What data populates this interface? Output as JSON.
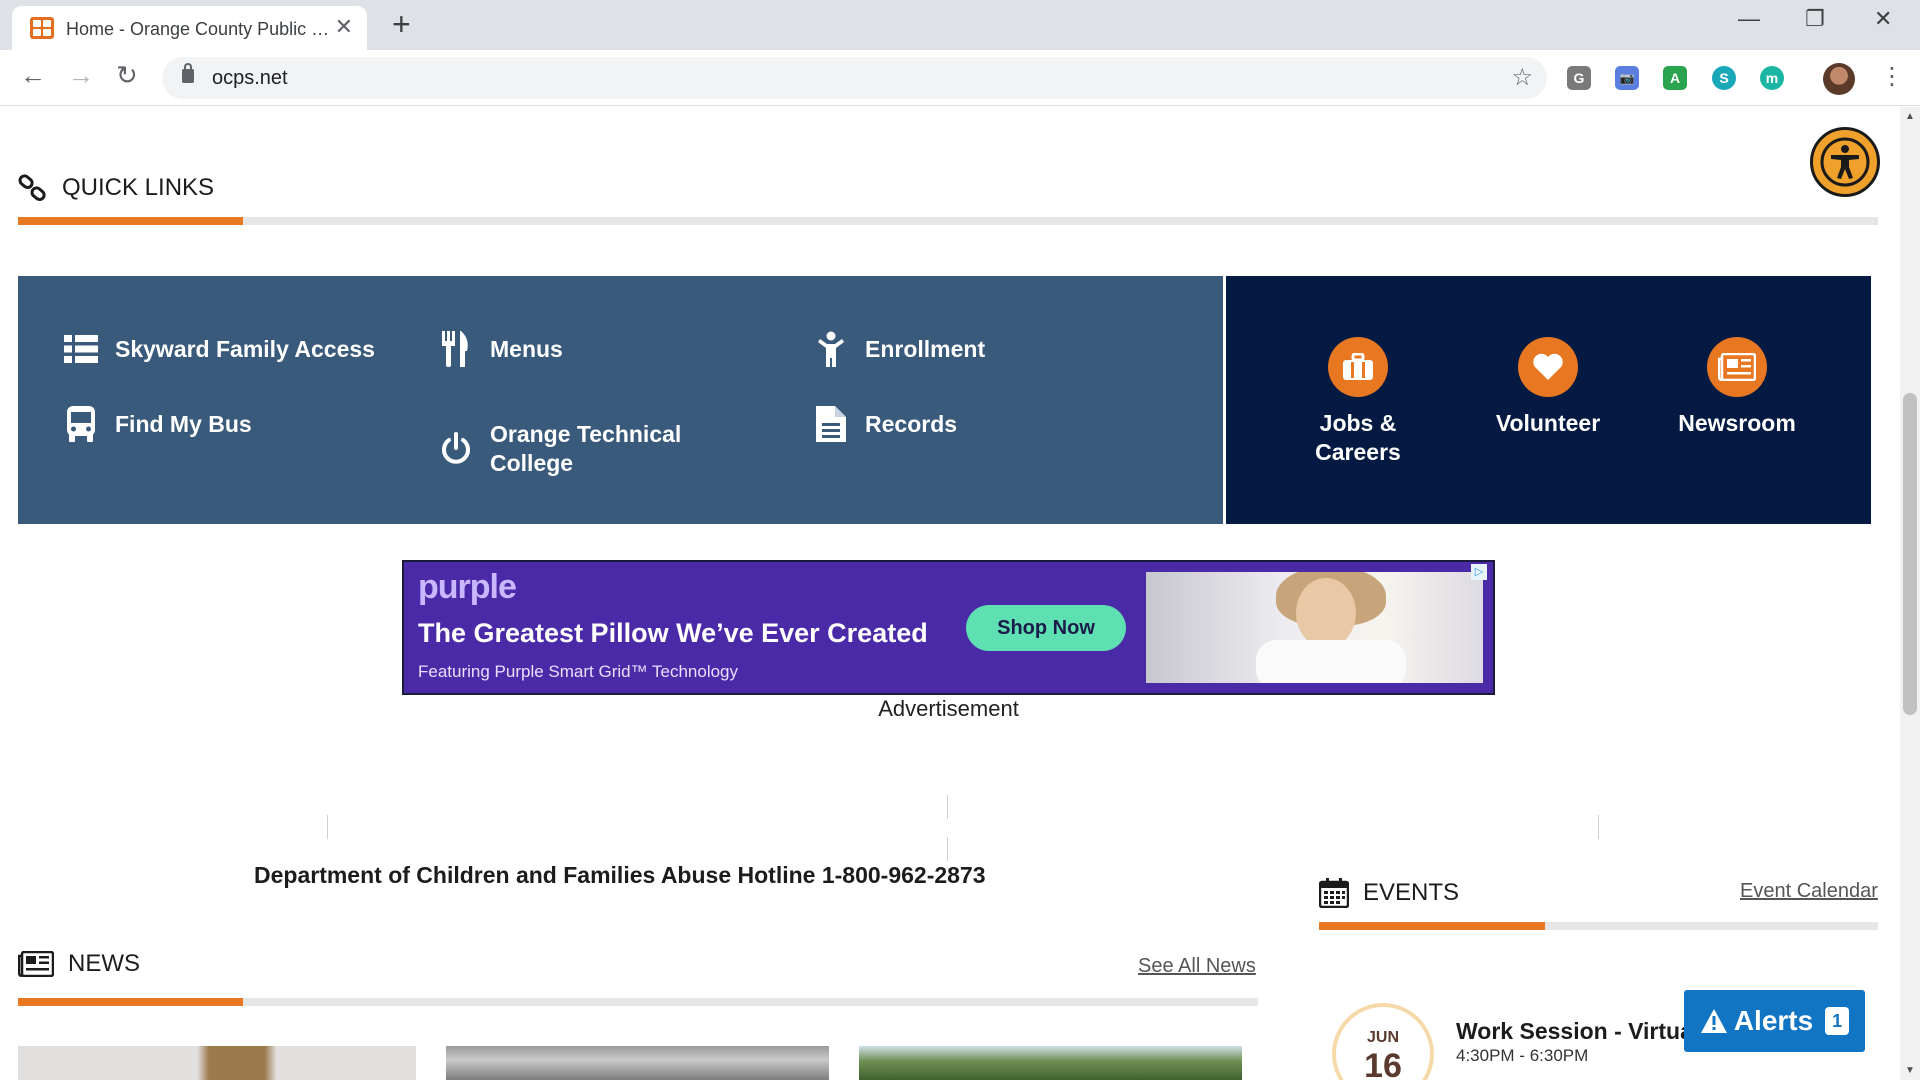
{
  "browser": {
    "tab_title": "Home - Orange County Public Schools",
    "url": "ocps.net",
    "new_tab": "+",
    "close_tab": "✕",
    "minimize": "—",
    "restore": "❐",
    "close_window": "✕",
    "back": "←",
    "forward": "→",
    "reload": "↻",
    "star": "☆",
    "extensions": [
      "G",
      "📷",
      "A",
      "S",
      "m"
    ],
    "menu": "⋮"
  },
  "quick_links": {
    "title": "QUICK LINKS",
    "items": [
      {
        "label": "Skyward Family Access",
        "icon": "list-icon"
      },
      {
        "label": "Menus",
        "icon": "utensils-icon"
      },
      {
        "label": "Enrollment",
        "icon": "child-icon"
      },
      {
        "label": "Find My Bus",
        "icon": "bus-icon"
      },
      {
        "label": "Orange Technical College",
        "icon": "power-icon"
      },
      {
        "label": "Records",
        "icon": "document-icon"
      }
    ],
    "features": [
      {
        "label": "Jobs & Careers",
        "icon": "briefcase-icon"
      },
      {
        "label": "Volunteer",
        "icon": "heart-icon"
      },
      {
        "label": "Newsroom",
        "icon": "newspaper-icon"
      }
    ]
  },
  "ad": {
    "brand": "purple",
    "headline": "The Greatest Pillow We’ve Ever Created",
    "subline": "Featuring Purple Smart Grid™ Technology",
    "cta": "Shop Now",
    "choice": "▷",
    "label": "Advertisement"
  },
  "hotline": "Department of Children and Families Abuse Hotline 1-800-962-2873",
  "news": {
    "title": "NEWS",
    "see_all": "See All News"
  },
  "events": {
    "title": "EVENTS",
    "calendar_link": "Event Calendar",
    "items": [
      {
        "month": "JUN",
        "day": "16",
        "title": "Work Session - Virtual",
        "time": "4:30PM - 6:30PM"
      }
    ]
  },
  "alerts": {
    "label": "Alerts",
    "count": "1"
  },
  "colors": {
    "accent": "#e87722",
    "quick_panel": "#395a7b",
    "feature_panel": "#041a42",
    "alerts": "#1175c4"
  }
}
